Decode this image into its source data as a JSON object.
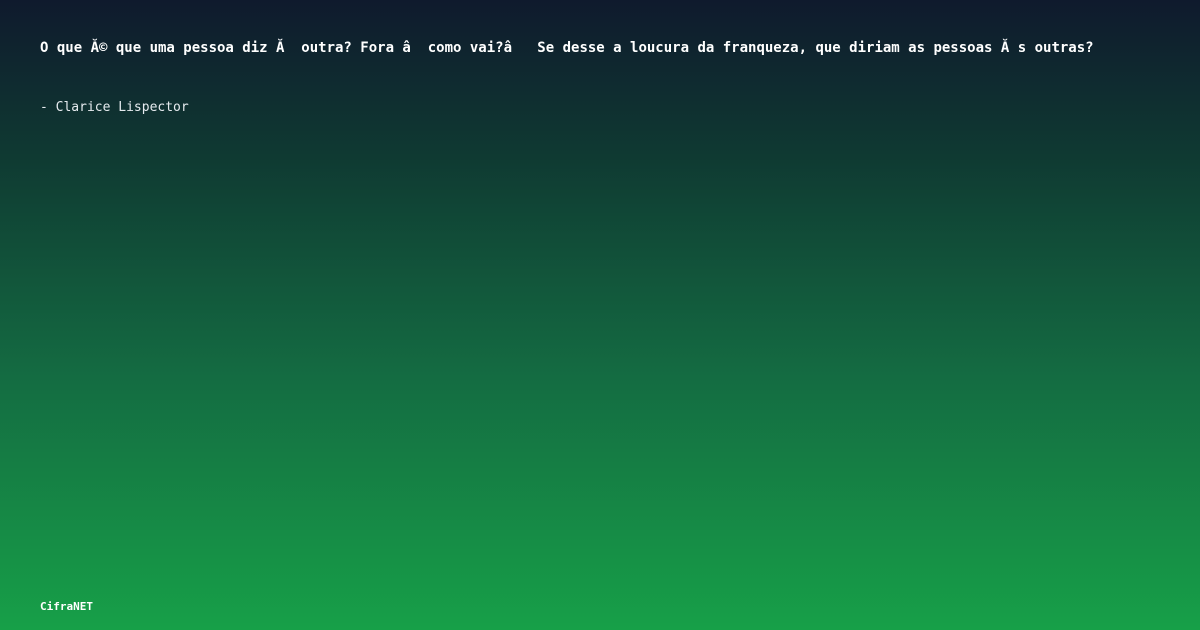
{
  "quote": {
    "text": "O que Ă© que uma pessoa diz Ă  outra? Fora â  como vai?â   Se desse a loucura da franqueza, que diriam as pessoas Ă s outras?"
  },
  "author": {
    "line": "- Clarice Lispector"
  },
  "brand": {
    "name": "CifraNET"
  },
  "colors": {
    "background_top": "#0f1a2d",
    "background_bottom": "#17a048",
    "text": "#ffffff"
  }
}
